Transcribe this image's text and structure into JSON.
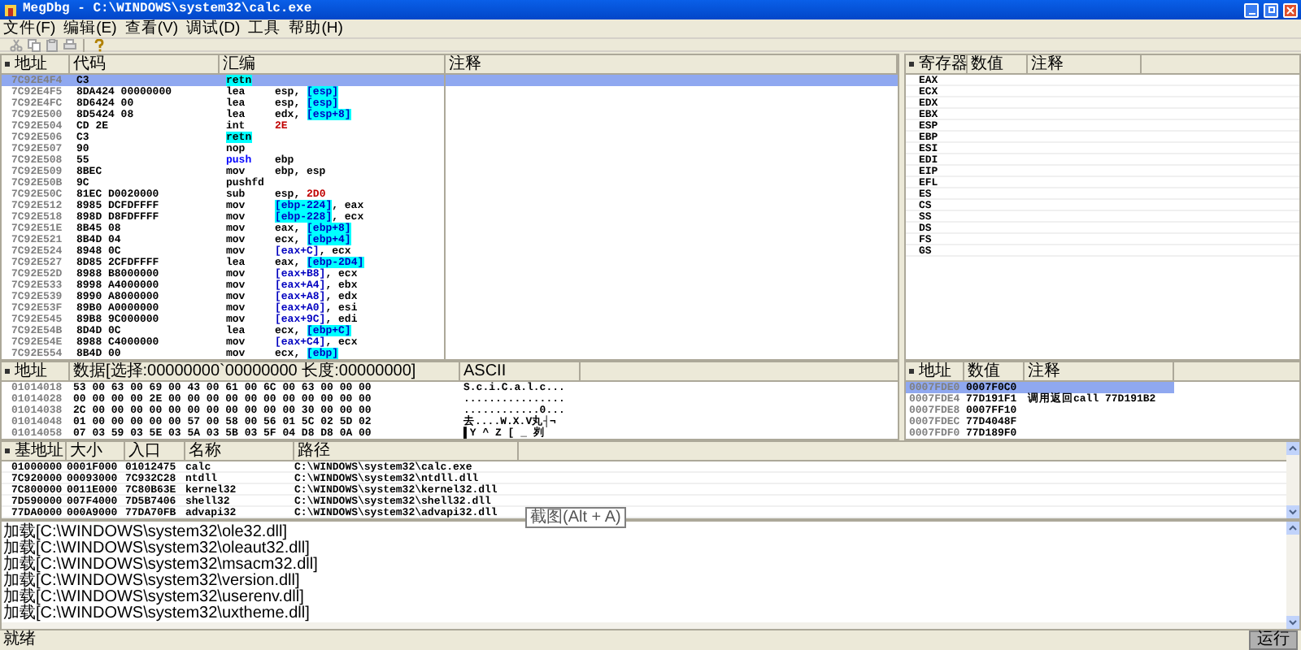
{
  "window": {
    "title": "MegDbg - C:\\WINDOWS\\system32\\calc.exe"
  },
  "menu": [
    "文件(F)",
    "编辑(E)",
    "查看(V)",
    "调试(D)",
    "工具",
    "帮助(H)"
  ],
  "toolbar": [
    {
      "kind": "cut",
      "disabled": true
    },
    {
      "kind": "copy",
      "disabled": true
    },
    {
      "kind": "paste",
      "disabled": true
    },
    {
      "kind": "print",
      "disabled": true
    },
    {
      "kind": "help",
      "disabled": false
    }
  ],
  "disassembly": {
    "columns": [
      "地址",
      "代码",
      "汇编",
      "注释"
    ],
    "rows": [
      {
        "address": "7C92E4F4",
        "code": "C3",
        "mnemonic": {
          "text": "retn",
          "kind": "ret"
        },
        "ops": [],
        "selected": true
      },
      {
        "address": "7C92E4F5",
        "code": "8DA424 00000000",
        "mnemonic": {
          "text": "lea",
          "kind": "normal"
        },
        "ops": [
          {
            "text": "esp, ",
            "kind": "reg"
          },
          {
            "text": "[esp]",
            "kind": "stack"
          }
        ],
        "selected": false
      },
      {
        "address": "7C92E4FC",
        "code": "8D6424 00",
        "mnemonic": {
          "text": "lea",
          "kind": "normal"
        },
        "ops": [
          {
            "text": "esp, ",
            "kind": "reg"
          },
          {
            "text": "[esp]",
            "kind": "stack"
          }
        ],
        "selected": false
      },
      {
        "address": "7C92E500",
        "code": "8D5424 08",
        "mnemonic": {
          "text": "lea",
          "kind": "normal"
        },
        "ops": [
          {
            "text": "edx, ",
            "kind": "reg"
          },
          {
            "text": "[esp+8]",
            "kind": "stack"
          }
        ],
        "selected": false
      },
      {
        "address": "7C92E504",
        "code": "CD 2E",
        "mnemonic": {
          "text": "int",
          "kind": "normal"
        },
        "ops": [
          {
            "text": "2E",
            "kind": "imm"
          }
        ],
        "selected": false
      },
      {
        "address": "7C92E506",
        "code": "C3",
        "mnemonic": {
          "text": "retn",
          "kind": "ret"
        },
        "ops": [],
        "selected": false
      },
      {
        "address": "7C92E507",
        "code": "90",
        "mnemonic": {
          "text": "nop",
          "kind": "normal"
        },
        "ops": [],
        "selected": false
      },
      {
        "address": "7C92E508",
        "code": "55",
        "mnemonic": {
          "text": "push",
          "kind": "push"
        },
        "ops": [
          {
            "text": "ebp",
            "kind": "reg"
          }
        ],
        "selected": false
      },
      {
        "address": "7C92E509",
        "code": "8BEC",
        "mnemonic": {
          "text": "mov",
          "kind": "normal"
        },
        "ops": [
          {
            "text": "ebp, esp",
            "kind": "reg"
          }
        ],
        "selected": false
      },
      {
        "address": "7C92E50B",
        "code": "9C",
        "mnemonic": {
          "text": "pushfd",
          "kind": "normal"
        },
        "ops": [],
        "selected": false
      },
      {
        "address": "7C92E50C",
        "code": "81EC D0020000",
        "mnemonic": {
          "text": "sub",
          "kind": "normal"
        },
        "ops": [
          {
            "text": "esp, ",
            "kind": "reg"
          },
          {
            "text": "2D0",
            "kind": "imm"
          }
        ],
        "selected": false
      },
      {
        "address": "7C92E512",
        "code": "8985 DCFDFFFF",
        "mnemonic": {
          "text": "mov",
          "kind": "normal"
        },
        "ops": [
          {
            "text": "[ebp-224]",
            "kind": "stack"
          },
          {
            "text": ", eax",
            "kind": "reg"
          }
        ],
        "selected": false
      },
      {
        "address": "7C92E518",
        "code": "898D D8FDFFFF",
        "mnemonic": {
          "text": "mov",
          "kind": "normal"
        },
        "ops": [
          {
            "text": "[ebp-228]",
            "kind": "stack"
          },
          {
            "text": ", ecx",
            "kind": "reg"
          }
        ],
        "selected": false
      },
      {
        "address": "7C92E51E",
        "code": "8B45 08",
        "mnemonic": {
          "text": "mov",
          "kind": "normal"
        },
        "ops": [
          {
            "text": "eax, ",
            "kind": "reg"
          },
          {
            "text": "[ebp+8]",
            "kind": "stack"
          }
        ],
        "selected": false
      },
      {
        "address": "7C92E521",
        "code": "8B4D 04",
        "mnemonic": {
          "text": "mov",
          "kind": "normal"
        },
        "ops": [
          {
            "text": "ecx, ",
            "kind": "reg"
          },
          {
            "text": "[ebp+4]",
            "kind": "stack"
          }
        ],
        "selected": false
      },
      {
        "address": "7C92E524",
        "code": "8948 0C",
        "mnemonic": {
          "text": "mov",
          "kind": "normal"
        },
        "ops": [
          {
            "text": "[eax+C]",
            "kind": "mem"
          },
          {
            "text": ", ecx",
            "kind": "reg"
          }
        ],
        "selected": false
      },
      {
        "address": "7C92E527",
        "code": "8D85 2CFDFFFF",
        "mnemonic": {
          "text": "lea",
          "kind": "normal"
        },
        "ops": [
          {
            "text": "eax, ",
            "kind": "reg"
          },
          {
            "text": "[ebp-2D4]",
            "kind": "stack"
          }
        ],
        "selected": false
      },
      {
        "address": "7C92E52D",
        "code": "8988 B8000000",
        "mnemonic": {
          "text": "mov",
          "kind": "normal"
        },
        "ops": [
          {
            "text": "[eax+B8]",
            "kind": "mem"
          },
          {
            "text": ", ecx",
            "kind": "reg"
          }
        ],
        "selected": false
      },
      {
        "address": "7C92E533",
        "code": "8998 A4000000",
        "mnemonic": {
          "text": "mov",
          "kind": "normal"
        },
        "ops": [
          {
            "text": "[eax+A4]",
            "kind": "mem"
          },
          {
            "text": ", ebx",
            "kind": "reg"
          }
        ],
        "selected": false
      },
      {
        "address": "7C92E539",
        "code": "8990 A8000000",
        "mnemonic": {
          "text": "mov",
          "kind": "normal"
        },
        "ops": [
          {
            "text": "[eax+A8]",
            "kind": "mem"
          },
          {
            "text": ", edx",
            "kind": "reg"
          }
        ],
        "selected": false
      },
      {
        "address": "7C92E53F",
        "code": "89B0 A0000000",
        "mnemonic": {
          "text": "mov",
          "kind": "normal"
        },
        "ops": [
          {
            "text": "[eax+A0]",
            "kind": "mem"
          },
          {
            "text": ", esi",
            "kind": "reg"
          }
        ],
        "selected": false
      },
      {
        "address": "7C92E545",
        "code": "89B8 9C000000",
        "mnemonic": {
          "text": "mov",
          "kind": "normal"
        },
        "ops": [
          {
            "text": "[eax+9C]",
            "kind": "mem"
          },
          {
            "text": ", edi",
            "kind": "reg"
          }
        ],
        "selected": false
      },
      {
        "address": "7C92E54B",
        "code": "8D4D 0C",
        "mnemonic": {
          "text": "lea",
          "kind": "normal"
        },
        "ops": [
          {
            "text": "ecx, ",
            "kind": "reg"
          },
          {
            "text": "[ebp+C]",
            "kind": "stack"
          }
        ],
        "selected": false
      },
      {
        "address": "7C92E54E",
        "code": "8988 C4000000",
        "mnemonic": {
          "text": "mov",
          "kind": "normal"
        },
        "ops": [
          {
            "text": "[eax+C4]",
            "kind": "mem"
          },
          {
            "text": ", ecx",
            "kind": "reg"
          }
        ],
        "selected": false
      },
      {
        "address": "7C92E554",
        "code": "8B4D 00",
        "mnemonic": {
          "text": "mov",
          "kind": "normal"
        },
        "ops": [
          {
            "text": "ecx, ",
            "kind": "reg"
          },
          {
            "text": "[ebp]",
            "kind": "stack"
          }
        ],
        "selected": false
      }
    ]
  },
  "registers": {
    "columns": [
      "寄存器",
      "数值",
      "注释"
    ],
    "names": [
      "EAX",
      "ECX",
      "EDX",
      "EBX",
      "ESP",
      "EBP",
      "ESI",
      "EDI",
      "EIP",
      "EFL",
      "ES",
      "CS",
      "SS",
      "DS",
      "FS",
      "GS"
    ]
  },
  "dump": {
    "columns": [
      "地址",
      "数据[选择:00000000`00000000 长度:00000000]",
      "ASCII"
    ],
    "rows": [
      {
        "address": "01014018",
        "hex": "53 00 63 00 69 00 43 00 61 00 6C 00 63 00 00 00",
        "ascii": "S.c.i.C.a.l.c..."
      },
      {
        "address": "01014028",
        "hex": "00 00 00 00 2E 00 00 00 00 00 00 00 00 00 00 00",
        "ascii": "................"
      },
      {
        "address": "01014038",
        "hex": "2C 00 00 00 00 00 00 00 00 00 00 00 30 00 00 00",
        "ascii": "............0..."
      },
      {
        "address": "01014048",
        "hex": "01 00 00 00 00 00 57 00 58 00 56 01 5C 02 5D 02",
        "ascii": "去....W.X.V丸┤¬"
      },
      {
        "address": "01014058",
        "hex": "07 03 59 03 5E 03 5A 03 5B 03 5F 04 D8 D8 0A 00",
        "ascii": "▌Y ^ Z [ _ 刿"
      }
    ]
  },
  "stack": {
    "columns": [
      "地址",
      "数值",
      "注释"
    ],
    "rows": [
      {
        "address": "0007FDE0",
        "value": "0007F0C0",
        "comment": "",
        "selected": true
      },
      {
        "address": "0007FDE4",
        "value": "77D191F1",
        "comment": "调用返回call 77D191B2",
        "selected": false
      },
      {
        "address": "0007FDE8",
        "value": "0007FF10",
        "comment": "",
        "selected": false
      },
      {
        "address": "0007FDEC",
        "value": "77D4048F",
        "comment": "",
        "selected": false
      },
      {
        "address": "0007FDF0",
        "value": "77D189F0",
        "comment": "",
        "selected": false
      }
    ]
  },
  "modules": {
    "columns": [
      "基地址",
      "大小",
      "入口",
      "名称",
      "路径"
    ],
    "rows": [
      [
        "01000000",
        "0001F000",
        "01012475",
        "calc",
        "C:\\WINDOWS\\system32\\calc.exe"
      ],
      [
        "7C920000",
        "00093000",
        "7C932C28",
        "ntdll",
        "C:\\WINDOWS\\system32\\ntdll.dll"
      ],
      [
        "7C800000",
        "0011E000",
        "7C80B63E",
        "kernel32",
        "C:\\WINDOWS\\system32\\kernel32.dll"
      ],
      [
        "7D590000",
        "007F4000",
        "7D5B7406",
        "shell32",
        "C:\\WINDOWS\\system32\\shell32.dll"
      ],
      [
        "77DA0000",
        "000A9000",
        "77DA70FB",
        "advapi32",
        "C:\\WINDOWS\\system32\\advapi32.dll"
      ]
    ]
  },
  "tooltip": "截图(Alt + A)",
  "log": [
    "加载[C:\\WINDOWS\\system32\\ole32.dll]",
    "加载[C:\\WINDOWS\\system32\\oleaut32.dll]",
    "加载[C:\\WINDOWS\\system32\\msacm32.dll]",
    "加载[C:\\WINDOWS\\system32\\version.dll]",
    "加载[C:\\WINDOWS\\system32\\userenv.dll]",
    "加载[C:\\WINDOWS\\system32\\uxtheme.dll]"
  ],
  "status_bar": {
    "message": "就绪",
    "state": "运行"
  }
}
